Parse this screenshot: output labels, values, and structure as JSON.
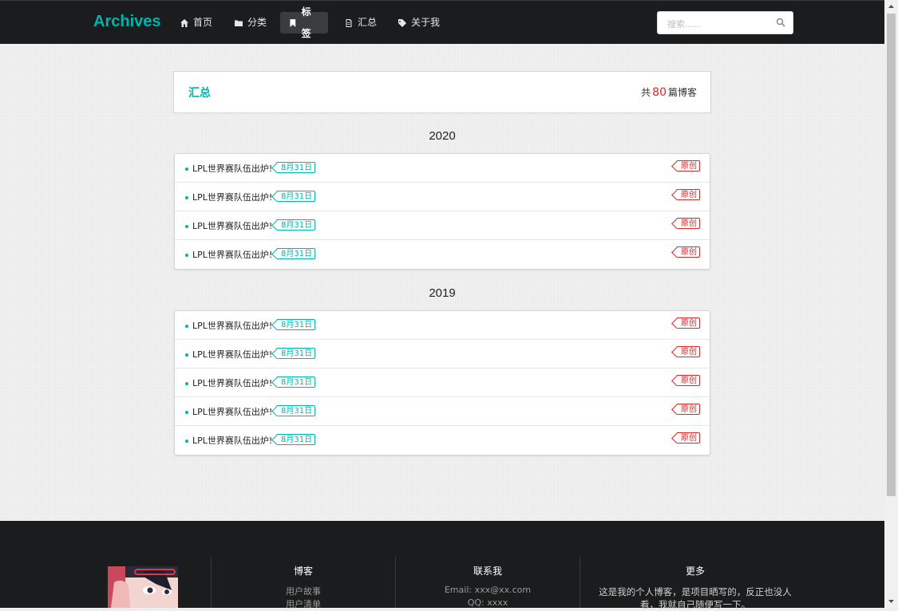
{
  "nav": {
    "brand": "Archives",
    "items": [
      {
        "label": "首页",
        "icon": "home-icon"
      },
      {
        "label": "分类",
        "icon": "folder-icon"
      },
      {
        "label": "标签",
        "icon": "bookmark-icon",
        "active": true
      },
      {
        "label": "汇总",
        "icon": "file-icon"
      },
      {
        "label": "关于我",
        "icon": "tag-icon"
      }
    ],
    "search_placeholder": "搜索......"
  },
  "summary": {
    "title": "汇总",
    "count_prefix": "共",
    "count": "80",
    "count_suffix": "篇博客"
  },
  "years": [
    {
      "year": "2020",
      "posts": [
        {
          "title": "LPL世界赛队伍出炉!",
          "date": "8月31日",
          "type": "原创"
        },
        {
          "title": "LPL世界赛队伍出炉!",
          "date": "8月31日",
          "type": "原创"
        },
        {
          "title": "LPL世界赛队伍出炉!",
          "date": "8月31日",
          "type": "原创"
        },
        {
          "title": "LPL世界赛队伍出炉!",
          "date": "8月31日",
          "type": "原创"
        }
      ]
    },
    {
      "year": "2019",
      "posts": [
        {
          "title": "LPL世界赛队伍出炉!",
          "date": "8月31日",
          "type": "原创"
        },
        {
          "title": "LPL世界赛队伍出炉!",
          "date": "8月31日",
          "type": "原创"
        },
        {
          "title": "LPL世界赛队伍出炉!",
          "date": "8月31日",
          "type": "原创"
        },
        {
          "title": "LPL世界赛队伍出炉!",
          "date": "8月31日",
          "type": "原创"
        },
        {
          "title": "LPL世界赛队伍出炉!",
          "date": "8月31日",
          "type": "原创"
        }
      ]
    }
  ],
  "footer": {
    "blog": {
      "title": "博客",
      "links": [
        "用户故事",
        "用户清单"
      ]
    },
    "contact": {
      "title": "联系我",
      "lines": [
        "Email: xxx@xx.com",
        "QQ: xxxx"
      ]
    },
    "more": {
      "title": "更多",
      "text": "这是我的个人博客，是项目晒写的，反正也没人看，我就自己随便写一下。"
    }
  },
  "colors": {
    "accent": "#00b5ad",
    "original": "#db2828",
    "nav_bg": "#1b1c1d"
  }
}
